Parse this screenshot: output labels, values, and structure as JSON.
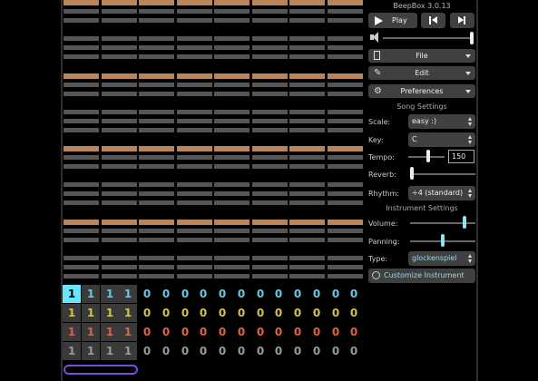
{
  "app": {
    "version": "BeepBox 3.0.13"
  },
  "transport": {
    "play_label": "Play"
  },
  "menus": {
    "file": "File",
    "edit": "Edit",
    "preferences": "Preferences"
  },
  "song_settings": {
    "title": "Song Settings",
    "scale_label": "Scale:",
    "scale_value": "easy :)",
    "key_label": "Key:",
    "key_value": "C",
    "tempo_label": "Tempo:",
    "tempo_value": "150",
    "reverb_label": "Reverb:",
    "rhythm_label": "Rhythm:",
    "rhythm_value": "÷4 (standard)"
  },
  "instrument_settings": {
    "title": "Instrument Settings",
    "volume_label": "Volume:",
    "panning_label": "Panning:",
    "type_label": "Type:",
    "type_value": "glockenspiel",
    "customize_label": "Customize Instrument"
  },
  "levels": {
    "master_volume": 1.0,
    "tempo_slider": 0.55,
    "reverb": 0.0,
    "instrument_volume": 0.85,
    "panning": 0.5
  },
  "piano_roll": {
    "bars": 8,
    "highlight_rows": [
      0,
      8,
      16,
      24
    ]
  },
  "pattern_grid": {
    "rows": [
      {
        "color": "#66c8e6",
        "values": [
          "1",
          "1",
          "1",
          "1",
          "0",
          "0",
          "0",
          "0",
          "0",
          "0",
          "0",
          "0",
          "0",
          "0",
          "0",
          "0"
        ]
      },
      {
        "color": "#d4c24a",
        "values": [
          "1",
          "1",
          "1",
          "1",
          "0",
          "0",
          "0",
          "0",
          "0",
          "0",
          "0",
          "0",
          "0",
          "0",
          "0",
          "0"
        ]
      },
      {
        "color": "#e0643a",
        "values": [
          "1",
          "1",
          "1",
          "1",
          "0",
          "0",
          "0",
          "0",
          "0",
          "0",
          "0",
          "0",
          "0",
          "0",
          "0",
          "0"
        ]
      },
      {
        "color": "#9a9a9a",
        "values": [
          "1",
          "1",
          "1",
          "1",
          "0",
          "0",
          "0",
          "0",
          "0",
          "0",
          "0",
          "0",
          "0",
          "0",
          "0",
          "0"
        ]
      }
    ],
    "selected": [
      0,
      0
    ]
  },
  "colors": {
    "accent": "#66e6ff",
    "note_row": "#555555",
    "octave_row": "#b88458",
    "scroll": "#7a4dd6"
  }
}
